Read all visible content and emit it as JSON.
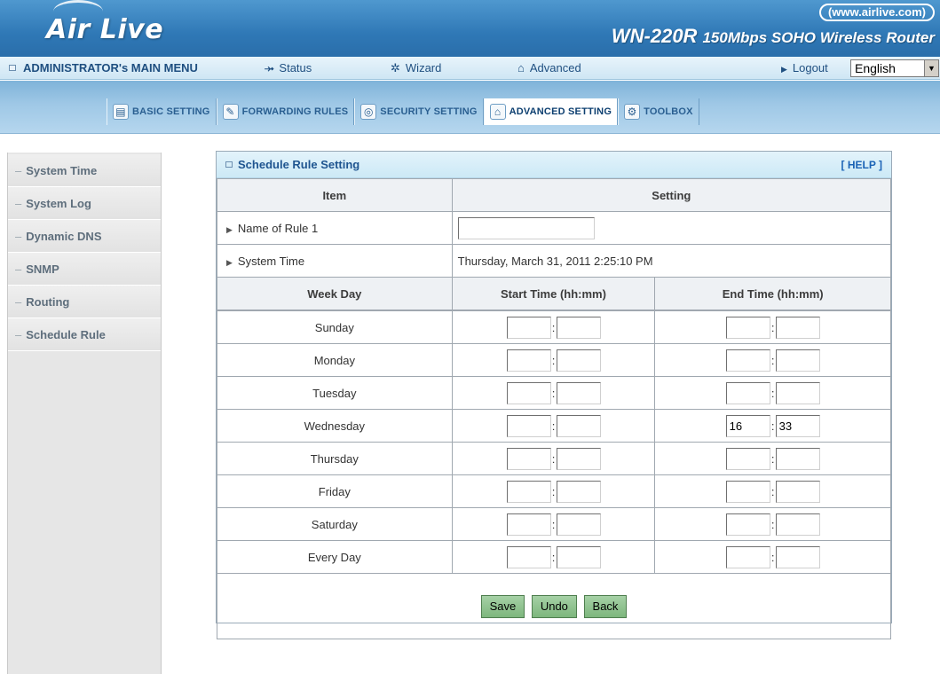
{
  "header": {
    "logo": "Air Live",
    "url": "(www.airlive.com)",
    "model": "WN-220R",
    "description": "150Mbps SOHO Wireless Router"
  },
  "main_menu": {
    "admin": "ADMINISTRATOR's MAIN MENU",
    "status": "Status",
    "wizard": "Wizard",
    "advanced": "Advanced",
    "logout": "Logout",
    "language": "English"
  },
  "tabs": [
    {
      "label": "BASIC SETTING",
      "icon": "folder-icon"
    },
    {
      "label": "FORWARDING RULES",
      "icon": "pen-icon"
    },
    {
      "label": "SECURITY SETTING",
      "icon": "lock-icon"
    },
    {
      "label": "ADVANCED SETTING",
      "icon": "advanced-icon",
      "active": true
    },
    {
      "label": "TOOLBOX",
      "icon": "tools-icon"
    }
  ],
  "sidebar": {
    "items": [
      {
        "label": "System Time"
      },
      {
        "label": "System Log"
      },
      {
        "label": "Dynamic DNS"
      },
      {
        "label": "SNMP"
      },
      {
        "label": "Routing"
      },
      {
        "label": "Schedule Rule"
      }
    ]
  },
  "panel": {
    "title": "Schedule Rule Setting",
    "help": "[ HELP ]",
    "col_item": "Item",
    "col_setting": "Setting",
    "rule_name_label": "Name of Rule 1",
    "rule_name_value": "",
    "system_time_label": "System Time",
    "system_time_value": "Thursday, March 31, 2011 2:25:10 PM",
    "col_weekday": "Week Day",
    "col_start": "Start Time (hh:mm)",
    "col_end": "End Time (hh:mm)",
    "days": [
      {
        "name": "Sunday",
        "start_h": "",
        "start_m": "",
        "end_h": "",
        "end_m": ""
      },
      {
        "name": "Monday",
        "start_h": "",
        "start_m": "",
        "end_h": "",
        "end_m": ""
      },
      {
        "name": "Tuesday",
        "start_h": "",
        "start_m": "",
        "end_h": "",
        "end_m": ""
      },
      {
        "name": "Wednesday",
        "start_h": "",
        "start_m": "",
        "end_h": "16",
        "end_m": "33"
      },
      {
        "name": "Thursday",
        "start_h": "",
        "start_m": "",
        "end_h": "",
        "end_m": ""
      },
      {
        "name": "Friday",
        "start_h": "",
        "start_m": "",
        "end_h": "",
        "end_m": ""
      },
      {
        "name": "Saturday",
        "start_h": "",
        "start_m": "",
        "end_h": "",
        "end_m": ""
      },
      {
        "name": "Every Day",
        "start_h": "",
        "start_m": "",
        "end_h": "",
        "end_m": ""
      }
    ],
    "buttons": {
      "save": "Save",
      "undo": "Undo",
      "back": "Back"
    }
  },
  "colors": {
    "header_blue": "#2f78b6",
    "menu_bar": "#cfe6f4",
    "button_green": "#7db67d",
    "help_link": "#1a62b5"
  }
}
